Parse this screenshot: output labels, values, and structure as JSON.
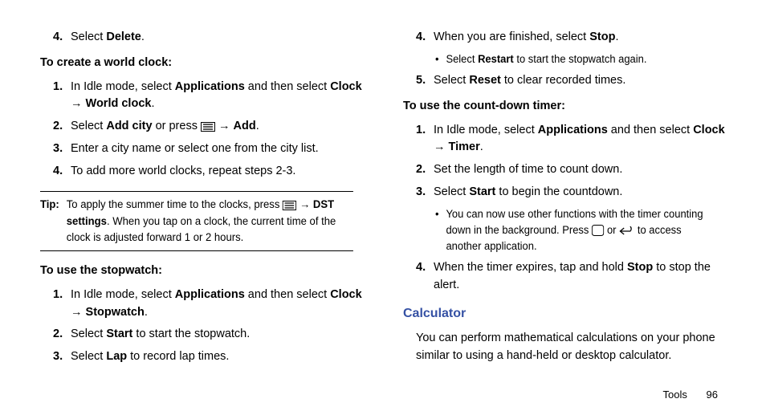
{
  "left": {
    "step4_prev": {
      "num": "4.",
      "pre": "Select ",
      "b": "Delete",
      "post": "."
    },
    "worldclock_heading": "To create a world clock:",
    "wc1": {
      "num": "1.",
      "pre": "In Idle mode, select ",
      "b1": "Applications",
      "mid": " and then select ",
      "b2": "Clock",
      "arrow": " → ",
      "b3": "World clock",
      "post": "."
    },
    "wc2": {
      "num": "2.",
      "pre": "Select ",
      "b1": "Add city",
      "mid": " or press  ",
      "arrow": " → ",
      "b2": "Add",
      "post": "."
    },
    "wc3": {
      "num": "3.",
      "text": "Enter a city name or select one from the city list."
    },
    "wc4": {
      "num": "4.",
      "text": "To add more world clocks, repeat steps 2-3."
    },
    "tip": {
      "label": "Tip:",
      "pre": "To apply the summer time to the clocks, press  ",
      "arrow": " → ",
      "b": "DST settings",
      "post": ". When you tap on a clock, the current time of the clock is adjusted forward 1 or 2 hours."
    },
    "stopwatch_heading": "To use the stopwatch:",
    "sw1": {
      "num": "1.",
      "pre": "In Idle mode, select ",
      "b1": "Applications",
      "mid": " and then select ",
      "b2": "Clock",
      "arrow": " → ",
      "b3": "Stopwatch",
      "post": "."
    },
    "sw2": {
      "num": "2.",
      "pre": "Select ",
      "b": "Start",
      "post": " to start the stopwatch."
    },
    "sw3": {
      "num": "3.",
      "pre": "Select ",
      "b": "Lap",
      "post": " to record lap times."
    }
  },
  "right": {
    "sw4": {
      "num": "4.",
      "pre": "When you are finished, select ",
      "b": "Stop",
      "post": "."
    },
    "sw4a": {
      "pre": "Select ",
      "b": "Restart",
      "post": " to start the stopwatch again."
    },
    "sw5": {
      "num": "5.",
      "pre": "Select ",
      "b": "Reset",
      "post": " to clear recorded times."
    },
    "timer_heading": "To use the count-down timer:",
    "t1": {
      "num": "1.",
      "pre": "In Idle mode, select ",
      "b1": "Applications",
      "mid": " and then select ",
      "b2": "Clock",
      "arrow": " → ",
      "b3": "Timer",
      "post": "."
    },
    "t2": {
      "num": "2.",
      "text": "Set the length of time to count down."
    },
    "t3": {
      "num": "3.",
      "pre": "Select ",
      "b": "Start",
      "post": " to begin the countdown."
    },
    "t3a": {
      "pre": "You can now use other functions with the timer counting down in the background. Press ",
      "mid": " or  ",
      "post": "  to access another application."
    },
    "t4": {
      "num": "4.",
      "pre": "When the timer expires, tap and hold ",
      "b": "Stop",
      "post": " to stop the alert."
    },
    "calc_title": "Calculator",
    "calc_para": "You can perform mathematical calculations on your phone similar to using a hand-held or desktop calculator."
  },
  "footer": {
    "section": "Tools",
    "page": "96"
  }
}
